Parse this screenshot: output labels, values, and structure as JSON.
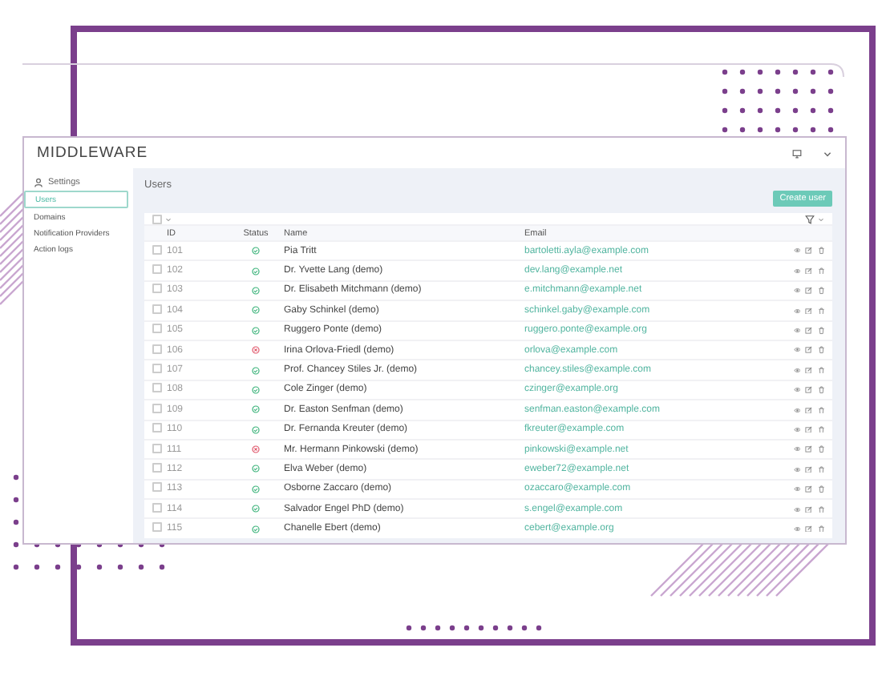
{
  "app": {
    "title": "MIDDLEWARE"
  },
  "sidebar": {
    "section": "Settings",
    "items": [
      {
        "label": "Users",
        "selected": true
      },
      {
        "label": "Domains",
        "selected": false
      },
      {
        "label": "Notification Providers",
        "selected": false
      },
      {
        "label": "Action logs",
        "selected": false
      }
    ]
  },
  "page": {
    "title": "Users",
    "create_button": "Create user"
  },
  "table": {
    "select_all": {
      "checked": false
    },
    "columns": [
      "ID",
      "Status",
      "Name",
      "Email"
    ],
    "rows": [
      {
        "checked": false,
        "id": "101",
        "active": true,
        "name": "Pia Tritt",
        "email": "bartoletti.ayla@example.com"
      },
      {
        "checked": false,
        "id": "102",
        "active": true,
        "name": "Dr. Yvette Lang (demo)",
        "email": "dev.lang@example.net"
      },
      {
        "checked": false,
        "id": "103",
        "active": true,
        "name": "Dr. Elisabeth Mitchmann (demo)",
        "email": "e.mitchmann@example.net"
      },
      {
        "checked": false,
        "id": "104",
        "active": true,
        "name": "Gaby Schinkel (demo)",
        "email": "schinkel.gaby@example.com"
      },
      {
        "checked": false,
        "id": "105",
        "active": true,
        "name": "Ruggero Ponte (demo)",
        "email": "ruggero.ponte@example.org"
      },
      {
        "checked": false,
        "id": "106",
        "active": false,
        "name": "Irina Orlova-Friedl (demo)",
        "email": "orlova@example.com"
      },
      {
        "checked": false,
        "id": "107",
        "active": true,
        "name": "Prof. Chancey Stiles Jr. (demo)",
        "email": "chancey.stiles@example.com"
      },
      {
        "checked": false,
        "id": "108",
        "active": true,
        "name": "Cole Zinger (demo)",
        "email": "czinger@example.org"
      },
      {
        "checked": false,
        "id": "109",
        "active": true,
        "name": "Dr. Easton Senfman (demo)",
        "email": "senfman.easton@example.com"
      },
      {
        "checked": false,
        "id": "110",
        "active": true,
        "name": "Dr. Fernanda Kreuter (demo)",
        "email": "fkreuter@example.com"
      },
      {
        "checked": false,
        "id": "111",
        "active": false,
        "name": "Mr. Hermann Pinkowski (demo)",
        "email": "pinkowski@example.net"
      },
      {
        "checked": false,
        "id": "112",
        "active": true,
        "name": "Elva Weber (demo)",
        "email": "eweber72@example.net"
      },
      {
        "checked": false,
        "id": "113",
        "active": true,
        "name": "Osborne Zaccaro (demo)",
        "email": "ozaccaro@example.com"
      },
      {
        "checked": false,
        "id": "114",
        "active": true,
        "name": "Salvador Engel PhD (demo)",
        "email": "s.engel@example.com"
      },
      {
        "checked": false,
        "id": "115",
        "active": true,
        "name": "Chanelle Ebert (demo)",
        "email": "cebert@example.org"
      }
    ]
  }
}
